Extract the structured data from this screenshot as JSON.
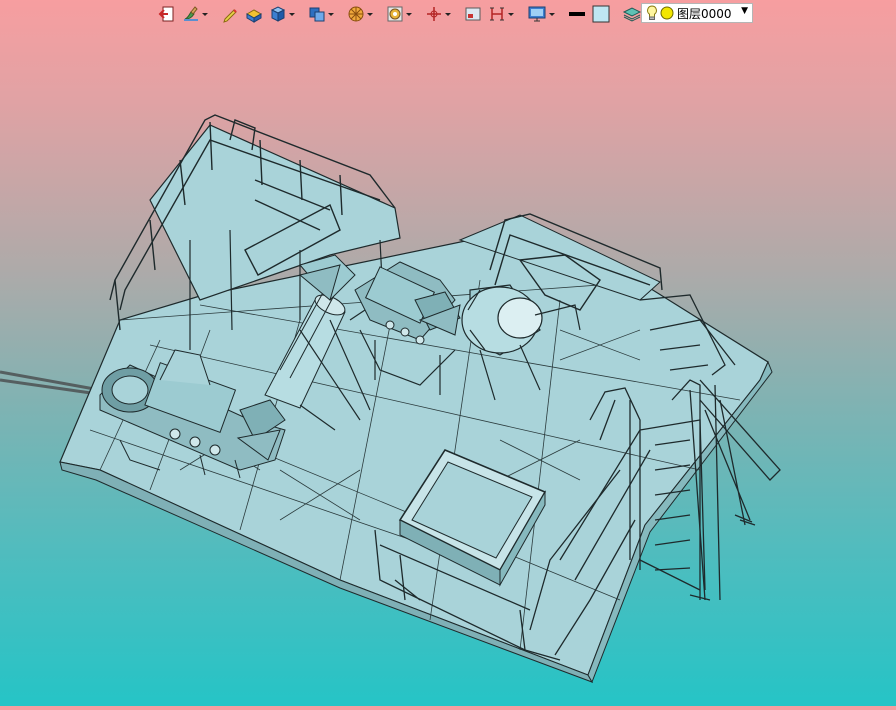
{
  "toolbar": {
    "buttons": [
      {
        "icon": "exit-icon",
        "caret": false
      },
      {
        "icon": "paint-tool-icon",
        "caret": true
      },
      {
        "icon": "pen-icon",
        "caret": false
      },
      {
        "icon": "box-plane-icon",
        "caret": false
      },
      {
        "icon": "cube-icon",
        "caret": true
      },
      {
        "icon": "view-cube-icon",
        "caret": true
      },
      {
        "icon": "section-icon",
        "caret": true
      },
      {
        "icon": "render-mode-icon",
        "caret": true
      },
      {
        "icon": "move-axis-icon",
        "caret": true
      },
      {
        "icon": "window-icon",
        "caret": false
      },
      {
        "icon": "measure-icon",
        "caret": true
      },
      {
        "icon": "screen-icon",
        "caret": true
      },
      {
        "icon": "line-color-icon",
        "caret": false
      },
      {
        "icon": "fill-color-icon",
        "caret": false
      },
      {
        "icon": "layers-icon",
        "caret": true
      }
    ],
    "colors": {
      "line": "#000000",
      "fill": "#bfe6f2"
    }
  },
  "layer": {
    "current": "图层0000",
    "bulb": "on",
    "color": "#f2e600"
  },
  "scene": {
    "background_top": "#f79ea0",
    "background_bottom": "#25c4c6",
    "model_color": "#a8d2d8",
    "edge_color": "#1e2a2c"
  }
}
